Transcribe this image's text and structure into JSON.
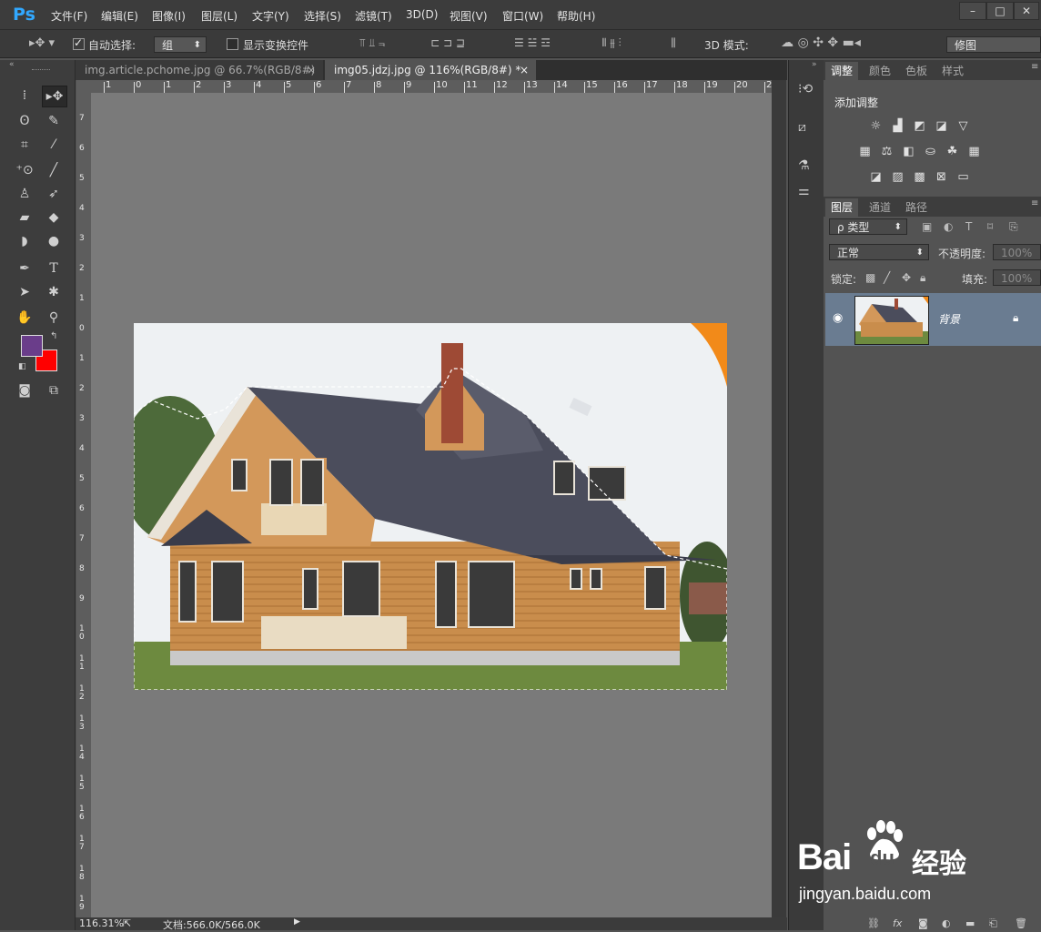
{
  "app": {
    "logo": "Ps",
    "menu": [
      "文件(F)",
      "编辑(E)",
      "图像(I)",
      "图层(L)",
      "文字(Y)",
      "选择(S)",
      "滤镜(T)",
      "3D(D)",
      "视图(V)",
      "窗口(W)",
      "帮助(H)"
    ],
    "window_buttons": [
      "–",
      "□",
      "✕"
    ]
  },
  "options_bar": {
    "auto_select_label": "自动选择:",
    "auto_select_checked": true,
    "auto_select_value": "组",
    "show_transform_label": "显示变换控件",
    "show_transform_checked": false,
    "mode_3d_label": "3D 模式:",
    "workspace_value": "修图"
  },
  "documents": {
    "tabs": [
      {
        "label": "img.article.pchome.jpg @ 66.7%(RGB/8#)",
        "close": "×",
        "active": false
      },
      {
        "label": "img05.jdzj.jpg @ 116%(RGB/8#) *",
        "close": "×",
        "active": true
      }
    ]
  },
  "rulers": {
    "top_labels": [
      "1",
      "0",
      "1",
      "2",
      "3",
      "4",
      "5",
      "6",
      "7",
      "8",
      "9",
      "10",
      "11",
      "12",
      "13",
      "14",
      "15",
      "16",
      "17",
      "18",
      "19",
      "20",
      "2"
    ],
    "left_labels": [
      "7",
      "6",
      "5",
      "4",
      "3",
      "2",
      "1",
      "0",
      "1",
      "2",
      "3",
      "4",
      "5",
      "6",
      "7",
      "8",
      "9",
      "10",
      "11",
      "12",
      "13",
      "14",
      "15",
      "16",
      "17",
      "18",
      "19"
    ]
  },
  "tools": {
    "foreground_color": "#6a3d8a",
    "background_color": "#ff0000"
  },
  "status": {
    "zoom": "116.31%",
    "doc_info": "文档:566.0K/566.0K",
    "arrow": "▶"
  },
  "adjust_panel": {
    "tabs": [
      "调整",
      "颜色",
      "色板",
      "样式"
    ],
    "title": "添加调整"
  },
  "layers_panel": {
    "tabs": [
      "图层",
      "通道",
      "路径"
    ],
    "filter_label": "ρ 类型",
    "blend_mode": "正常",
    "opacity_label": "不透明度:",
    "opacity_value": "100%",
    "lock_label": "锁定:",
    "fill_label": "填充:",
    "fill_value": "100%",
    "layers": [
      {
        "name": "背景",
        "visible": true,
        "locked": true
      }
    ]
  },
  "watermark": {
    "brand": "Bai",
    "brand2": "du",
    "suffix": "经验",
    "url": "jingyan.baidu.com"
  }
}
